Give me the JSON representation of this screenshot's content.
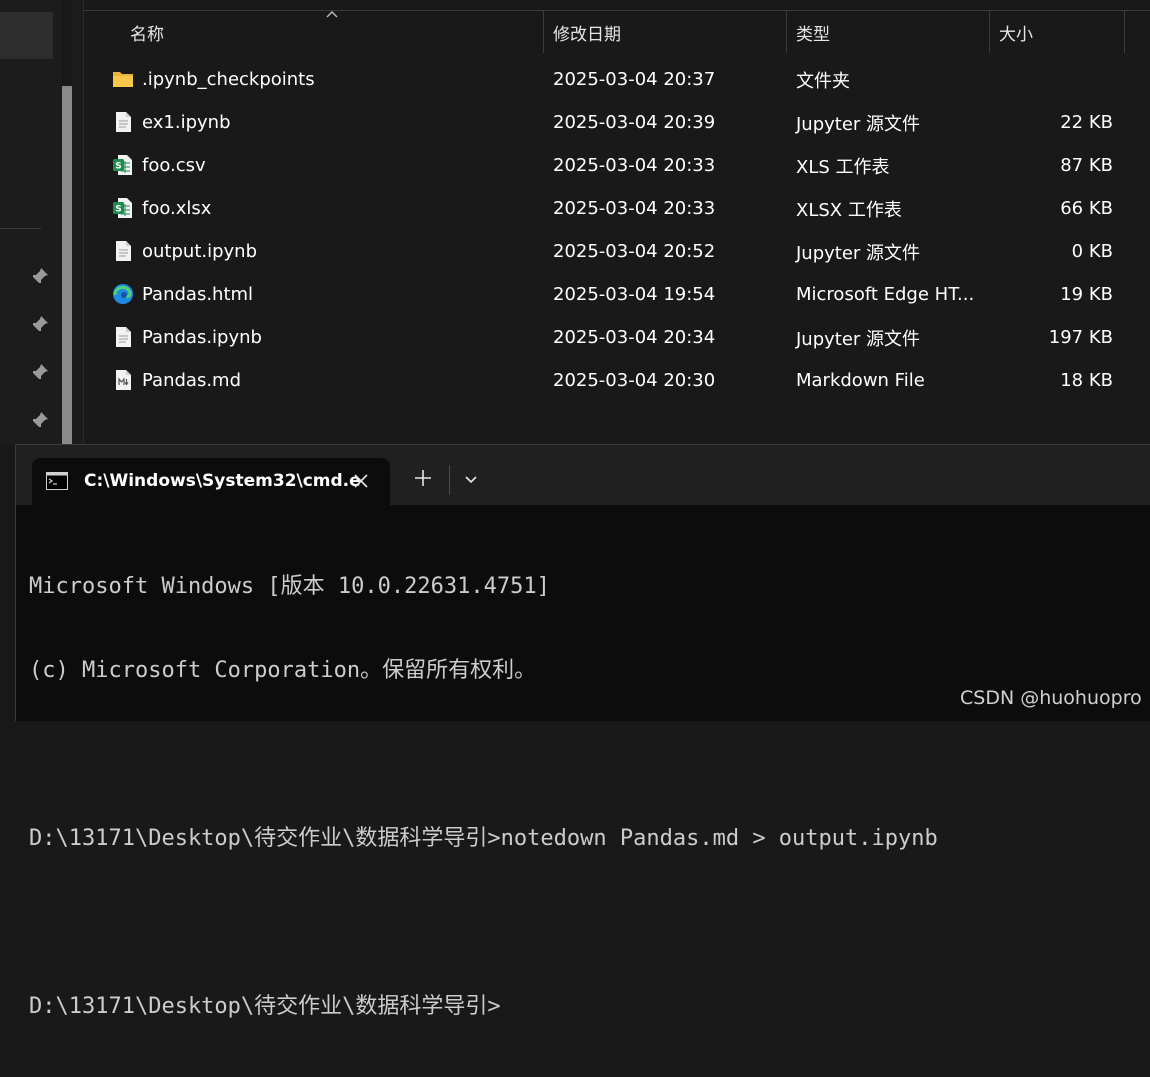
{
  "explorer": {
    "columns": {
      "name": "名称",
      "date": "修改日期",
      "type": "类型",
      "size": "大小"
    },
    "files": [
      {
        "name": ".ipynb_checkpoints",
        "date": "2025-03-04 20:37",
        "type": "文件夹",
        "size": "",
        "icon": "folder-icon"
      },
      {
        "name": "ex1.ipynb",
        "date": "2025-03-04 20:39",
        "type": "Jupyter 源文件",
        "size": "22 KB",
        "icon": "file-icon"
      },
      {
        "name": "foo.csv",
        "date": "2025-03-04 20:33",
        "type": "XLS 工作表",
        "size": "87 KB",
        "icon": "spreadsheet-icon"
      },
      {
        "name": "foo.xlsx",
        "date": "2025-03-04 20:33",
        "type": "XLSX 工作表",
        "size": "66 KB",
        "icon": "spreadsheet-icon"
      },
      {
        "name": "output.ipynb",
        "date": "2025-03-04 20:52",
        "type": "Jupyter 源文件",
        "size": "0 KB",
        "icon": "file-icon"
      },
      {
        "name": "Pandas.html",
        "date": "2025-03-04 19:54",
        "type": "Microsoft Edge HT...",
        "size": "19 KB",
        "icon": "edge-icon"
      },
      {
        "name": "Pandas.ipynb",
        "date": "2025-03-04 20:34",
        "type": "Jupyter 源文件",
        "size": "197 KB",
        "icon": "file-icon"
      },
      {
        "name": "Pandas.md",
        "date": "2025-03-04 20:30",
        "type": "Markdown File",
        "size": "18 KB",
        "icon": "markdown-file-icon"
      }
    ]
  },
  "terminal": {
    "tab_title": "C:\\Windows\\System32\\cmd.e",
    "lines": [
      "Microsoft Windows [版本 10.0.22631.4751]",
      "(c) Microsoft Corporation。保留所有权利。",
      "",
      "D:\\13171\\Desktop\\待交作业\\数据科学导引>notedown Pandas.md > output.ipynb",
      "",
      "D:\\13171\\Desktop\\待交作业\\数据科学导引>"
    ]
  },
  "watermark": "CSDN @huohuopro",
  "colors": {
    "explorer_bg": "#191919",
    "terminal_bg": "#0c0c0c",
    "tabbar_bg": "#202020",
    "folder": "#f7c64a",
    "spreadsheet": "#1d8d4f",
    "edge": "#1e8be0"
  }
}
